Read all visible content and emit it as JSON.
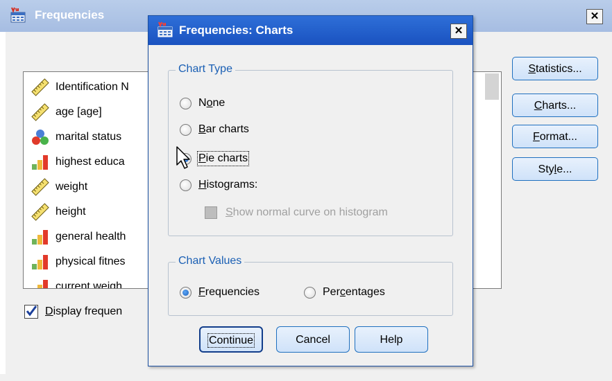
{
  "main_window": {
    "title": "Frequencies",
    "close_label": "✕",
    "variables": [
      {
        "label": "Identification N",
        "icon": "scale-ruler-icon"
      },
      {
        "label": "age [age]",
        "icon": "scale-ruler-icon"
      },
      {
        "label": "marital status",
        "icon": "nominal-circles-icon"
      },
      {
        "label": "highest educa",
        "icon": "ordinal-bars-icon"
      },
      {
        "label": "weight",
        "icon": "scale-ruler-icon"
      },
      {
        "label": "height",
        "icon": "scale-ruler-icon"
      },
      {
        "label": "general health",
        "icon": "ordinal-bars-icon"
      },
      {
        "label": "physical fitnes",
        "icon": "ordinal-bars-icon"
      },
      {
        "label": "current weigh",
        "icon": "ordinal-bars-icon"
      }
    ],
    "side_buttons": {
      "statistics": {
        "pre": "",
        "key": "S",
        "post": "tatistics..."
      },
      "charts": {
        "pre": "",
        "key": "C",
        "post": "harts..."
      },
      "format": {
        "pre": "",
        "key": "F",
        "post": "ormat..."
      },
      "style": {
        "pre": "Sty",
        "key": "l",
        "post": "e..."
      }
    },
    "display_checkbox": {
      "pre": "",
      "key": "D",
      "post": "isplay frequen",
      "checked": true
    }
  },
  "dialog": {
    "title": "Frequencies: Charts",
    "close_label": "✕",
    "chart_type": {
      "legend": "Chart Type",
      "none": {
        "pre": "N",
        "key": "o",
        "post": "ne"
      },
      "bar": {
        "pre": "",
        "key": "B",
        "post": "ar charts"
      },
      "pie": {
        "pre": "",
        "key": "P",
        "post": "ie charts"
      },
      "histograms": {
        "pre": "",
        "key": "H",
        "post": "istograms:"
      },
      "normal_curve": {
        "pre": "",
        "key": "S",
        "post": "how normal curve on histogram"
      },
      "selected": "pie"
    },
    "chart_values": {
      "legend": "Chart Values",
      "frequencies": {
        "pre": "",
        "key": "F",
        "post": "requencies"
      },
      "percentages": {
        "pre": "Per",
        "key": "c",
        "post": "entages"
      },
      "selected": "frequencies"
    },
    "buttons": {
      "continue": "Continue",
      "cancel": "Cancel",
      "help": "Help"
    }
  },
  "colors": {
    "title_active": "#1a52c0",
    "title_inactive": "#a6bde2",
    "group_legend": "#1a5fb4",
    "button_border": "#1e6fbf"
  }
}
